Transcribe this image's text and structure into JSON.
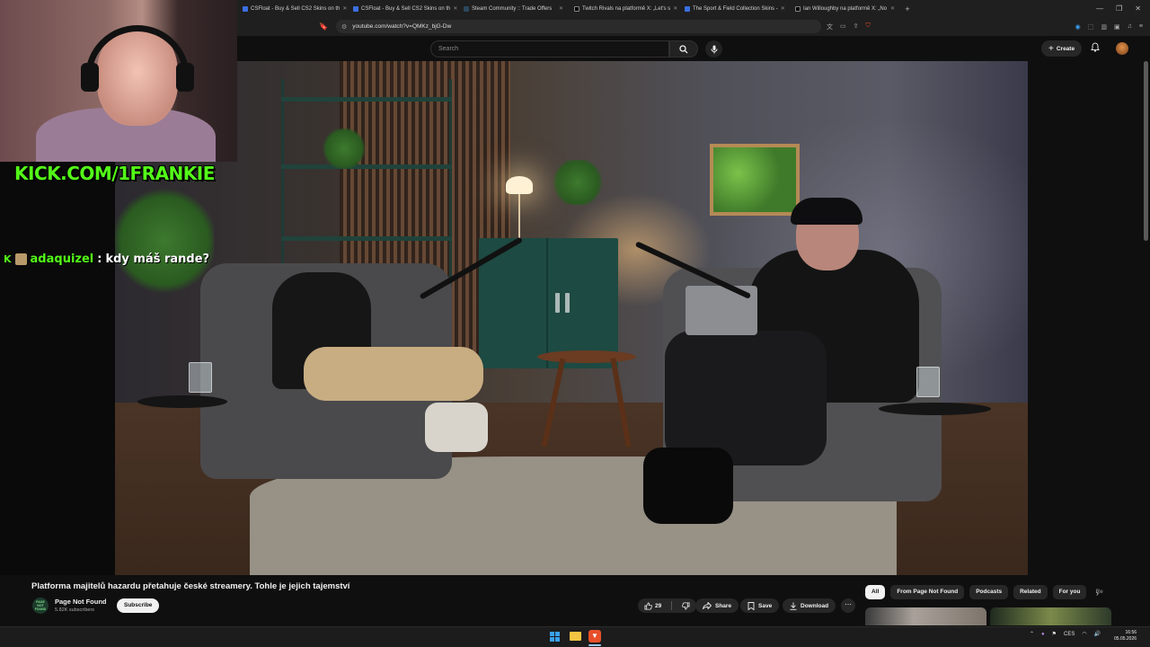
{
  "browser": {
    "tabs": [
      {
        "title": "CSFloat - Buy & Sell CS2 Skins on th"
      },
      {
        "title": "CSFloat - Buy & Sell CS2 Skins on th"
      },
      {
        "title": "Steam Community :: Trade Offers"
      },
      {
        "title": "Twitch Rivals na platformě X: „Let's s"
      },
      {
        "title": "The Sport & Field Collection Skins -"
      },
      {
        "title": "Ian Willoughby na platformě X: „No"
      }
    ],
    "url": "youtube.com/watch?v=QMKz_bjG-Dw"
  },
  "youtube": {
    "search_placeholder": "Search",
    "create_label": "Create"
  },
  "stream_overlay": {
    "kick_url": "KICK.COM/1FRANKIE",
    "chat": {
      "username": "adaquizel",
      "separator": ":",
      "message": "kdy máš rande?"
    }
  },
  "video": {
    "title": "Platforma majitelů hazardu přetahuje české streamery. Tohle je jejich tajemství",
    "channel_name": "Page Not Found",
    "channel_avatar_text": "PAGE NOT FOUND",
    "subscribers": "5.82K subscribers",
    "subscribe_label": "Subscribe",
    "like_count": "29",
    "share_label": "Share",
    "save_label": "Save",
    "download_label": "Download"
  },
  "filter_chips": [
    "All",
    "From Page Not Found",
    "Podcasts",
    "Related",
    "For you",
    "Re"
  ],
  "taskbar": {
    "language": "CES",
    "time": "16:56",
    "date": "05.05.2026"
  }
}
